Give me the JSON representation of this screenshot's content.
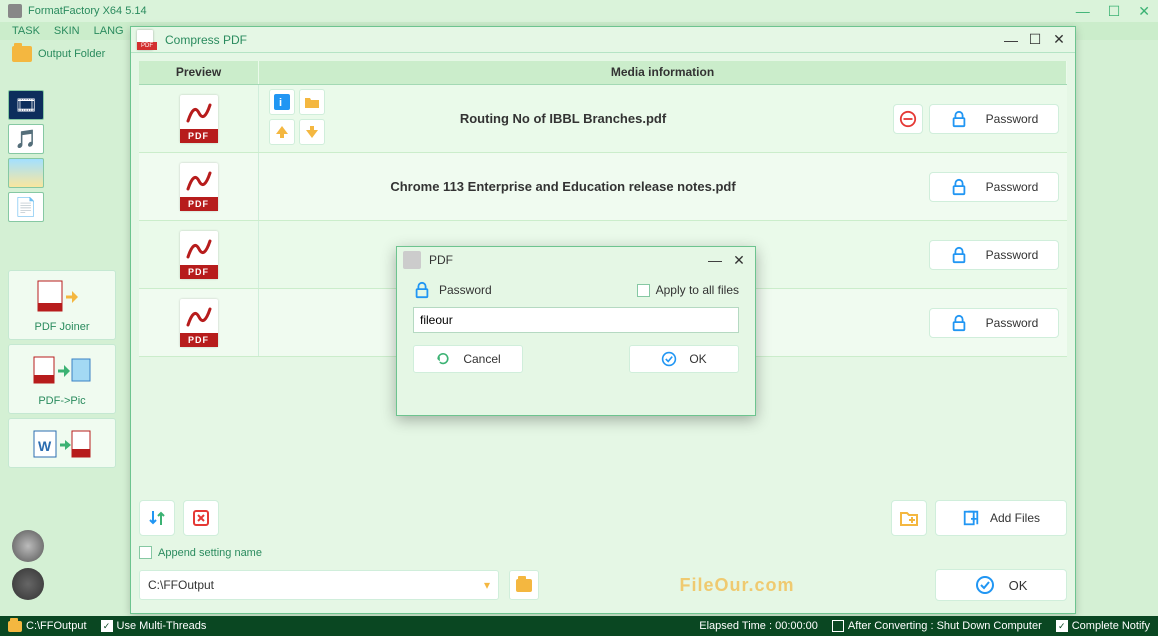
{
  "app": {
    "title": "FormatFactory X64 5.14",
    "menubar": [
      "TASK",
      "SKIN",
      "LANG"
    ],
    "output_folder_label": "Output Folder"
  },
  "side_tools": [
    {
      "label": "PDF Joiner"
    },
    {
      "label": "PDF->Pic"
    },
    {
      "label": ""
    }
  ],
  "child": {
    "title": "Compress PDF",
    "columns": {
      "preview": "Preview",
      "media": "Media information"
    },
    "rows": [
      {
        "filename": "Routing No of IBBL Branches.pdf",
        "password_label": "Password",
        "remove": true
      },
      {
        "filename": "Chrome 113 Enterprise and Education release notes.pdf",
        "password_label": "Password"
      },
      {
        "filename": "",
        "password_label": "Password"
      },
      {
        "filename": "",
        "password_label": "Password"
      }
    ],
    "pdf_badge": "PDF",
    "add_files_label": "Add Files",
    "append_label": "Append setting name",
    "dest_path": "C:\\FFOutput",
    "ok_label": "OK",
    "watermark": "FileOur.com"
  },
  "modal": {
    "title": "PDF",
    "password_label": "Password",
    "apply_all_label": "Apply to all files",
    "input_value": "fileour",
    "cancel_label": "Cancel",
    "ok_label": "OK"
  },
  "status": {
    "path": "C:\\FFOutput",
    "multi_threads": "Use Multi-Threads",
    "elapsed": "Elapsed Time : 00:00:00",
    "after_convert": "After Converting : Shut Down Computer",
    "complete_notify": "Complete Notify"
  }
}
